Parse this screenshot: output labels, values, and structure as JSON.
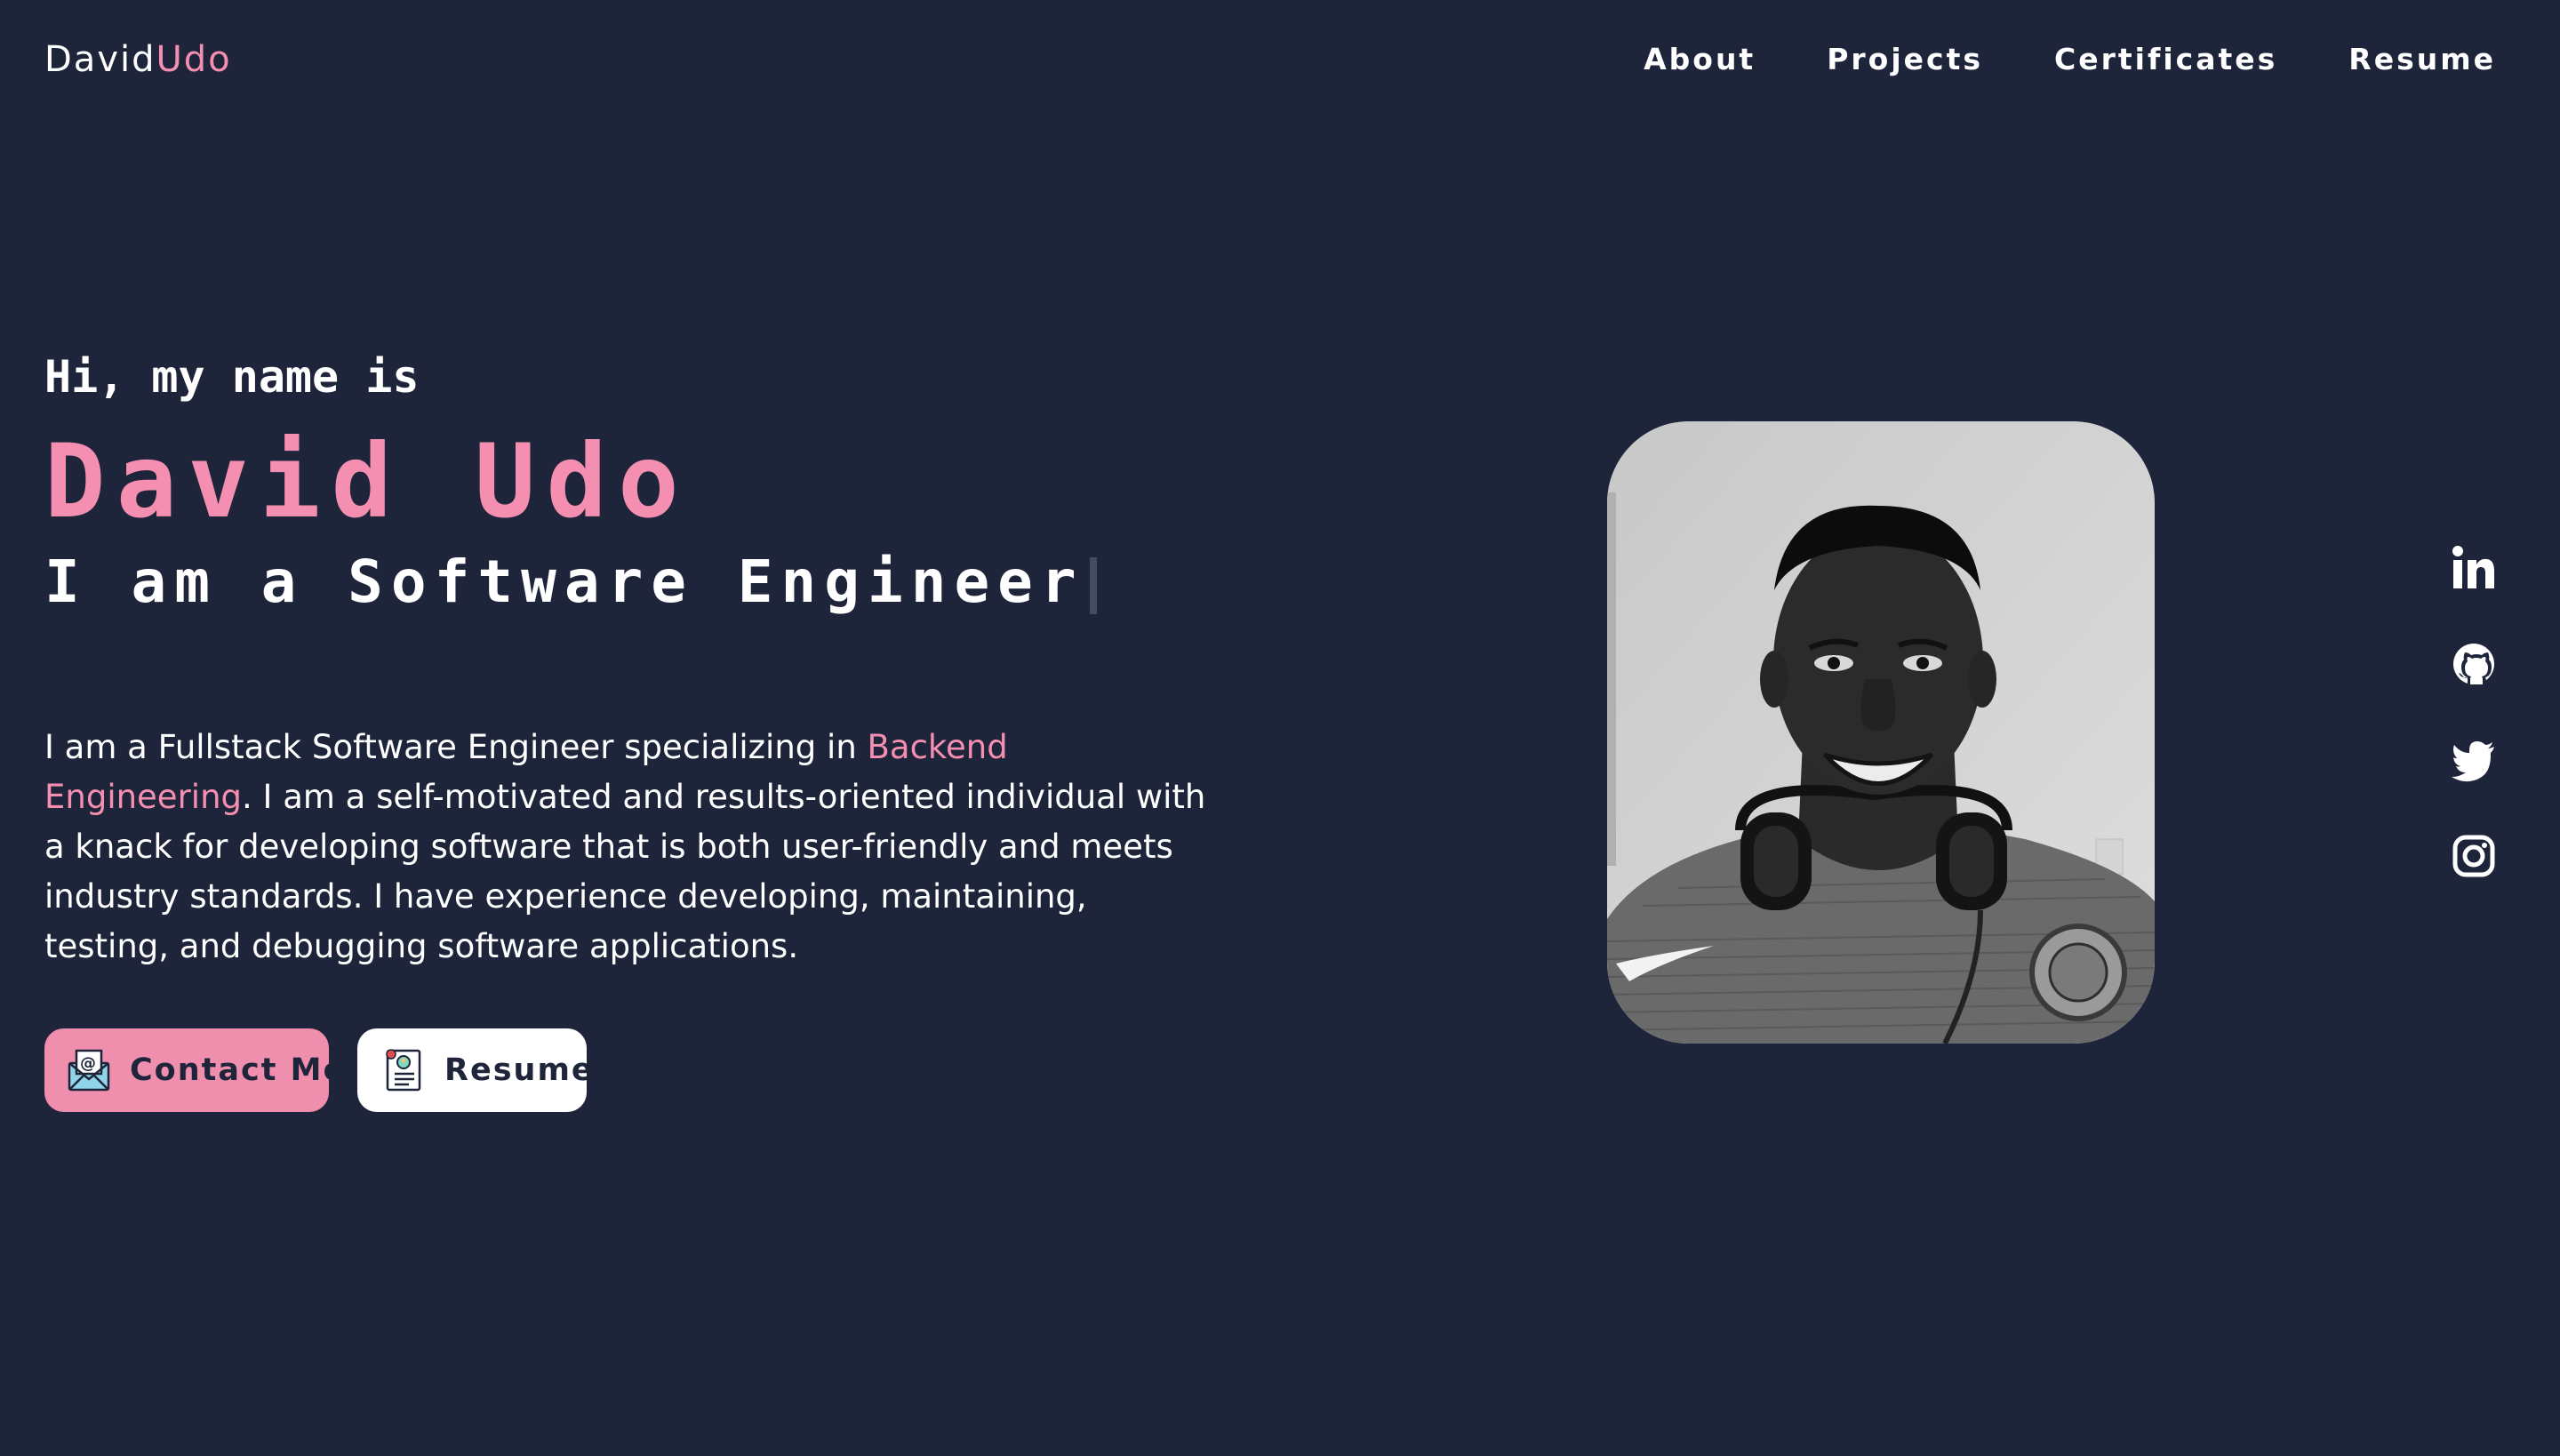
{
  "header": {
    "logo_first": "David",
    "logo_second": "Udo",
    "nav": [
      {
        "label": "About"
      },
      {
        "label": "Projects"
      },
      {
        "label": "Certificates"
      },
      {
        "label": "Resume"
      }
    ]
  },
  "hero": {
    "greeting": "Hi, my name is",
    "name": "David Udo",
    "role": "I am a Software Engineer",
    "bio_before": "I am a Fullstack Software Engineer specializing in ",
    "bio_highlight": "Backend Engineering",
    "bio_after": ". I am a self-motivated and results-oriented individual with a knack for developing software that is both user-friendly and meets industry standards. I have experience developing, maintaining, testing, and debugging software applications.",
    "contact_label": "Contact Me",
    "resume_label": "Resume"
  },
  "socials": [
    "linkedin-icon",
    "github-icon",
    "twitter-icon",
    "instagram-icon"
  ],
  "colors": {
    "background": "#1e253a",
    "accent": "#f48fb1",
    "text": "#ffffff"
  }
}
